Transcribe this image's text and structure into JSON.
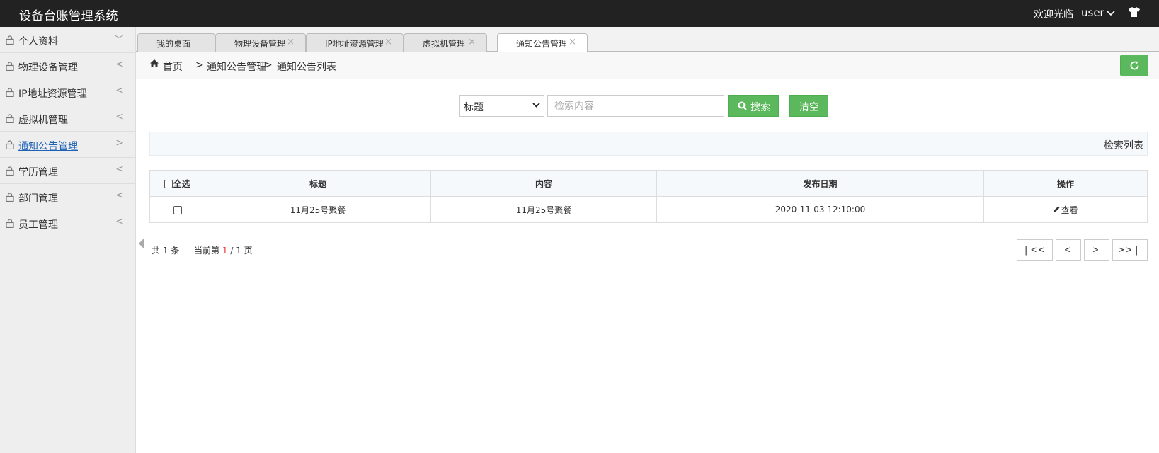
{
  "header": {
    "app_title": "设备台账管理系统",
    "welcome": "欢迎光临",
    "user": "user"
  },
  "sidebar": {
    "items": [
      {
        "label": "个人资料",
        "arrow": "﹀"
      },
      {
        "label": "物理设备管理",
        "arrow": "<"
      },
      {
        "label": "IP地址资源管理",
        "arrow": "<"
      },
      {
        "label": "虚拟机管理",
        "arrow": "<"
      },
      {
        "label": "通知公告管理",
        "arrow": ">"
      },
      {
        "label": "学历管理",
        "arrow": "<"
      },
      {
        "label": "部门管理",
        "arrow": "<"
      },
      {
        "label": "员工管理",
        "arrow": "<"
      }
    ]
  },
  "tabs": [
    {
      "label": "我的桌面",
      "close": ""
    },
    {
      "label": "物理设备管理",
      "close": "×"
    },
    {
      "label": "IP地址资源管理",
      "close": "×"
    },
    {
      "label": "虚拟机管理",
      "close": "×"
    },
    {
      "label": "通知公告管理",
      "close": "×"
    }
  ],
  "breadcrumb": {
    "home": "首页",
    "sep": ">",
    "level2": "通知公告管理",
    "level3": "通知公告列表"
  },
  "search": {
    "field_value": "标题",
    "placeholder": "检索内容",
    "search_label": "搜索",
    "clear_label": "清空"
  },
  "list_header": "检索列表",
  "table": {
    "select_all": "全选",
    "columns": [
      "标题",
      "内容",
      "发布日期",
      "操作"
    ],
    "rows": [
      {
        "title": "11月25号聚餐",
        "content": "11月25号聚餐",
        "date": "2020-11-03 12:10:00",
        "action": "查看"
      }
    ]
  },
  "pagination": {
    "total_prefix": "共",
    "total": "1",
    "total_suffix": "条",
    "current_prefix": "当前第",
    "current": "1",
    "pages": "/ 1 页",
    "first": "|<<",
    "prev": "<",
    "next": ">",
    "last": ">>|"
  },
  "colors": {
    "topbar": "#222222",
    "green": "#5cb85c",
    "active_link": "#1e62b5"
  }
}
